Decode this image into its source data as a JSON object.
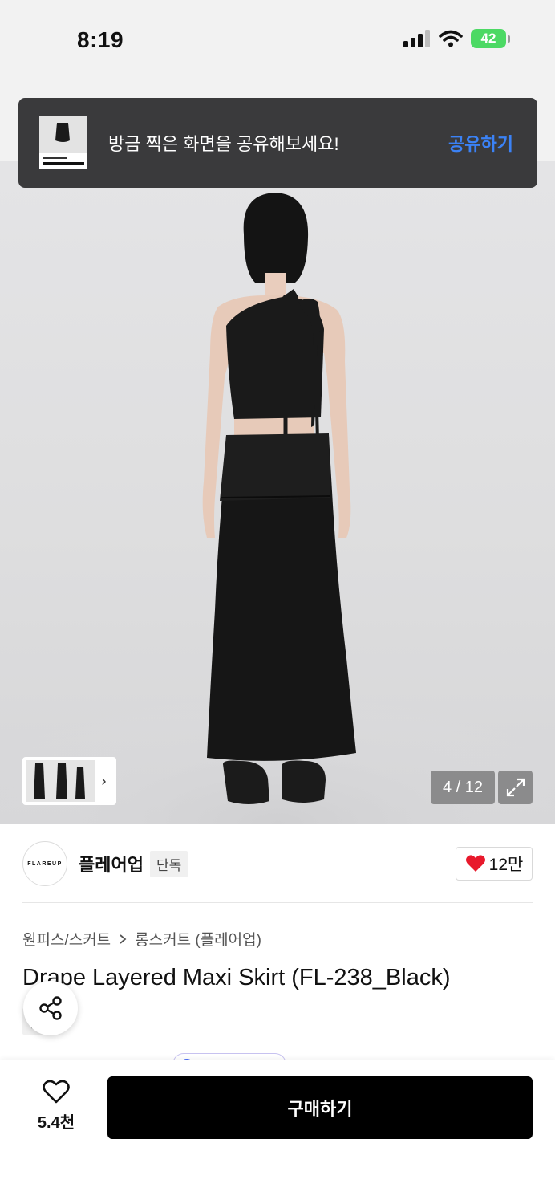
{
  "status_bar": {
    "time": "8:19",
    "battery": "42"
  },
  "toast": {
    "message": "방금 찍은 화면을 공유해보세요!",
    "action": "공유하기"
  },
  "gallery": {
    "counter": "4 / 12"
  },
  "brand": {
    "logo_text": "FLAREUP",
    "name": "플레어업",
    "badge": "단독",
    "likes": "12만"
  },
  "breadcrumb": {
    "category": "원피스/스커트",
    "sub_category": "롱스커트 (플레어업)"
  },
  "product": {
    "title": "Drape Layered Maxi Skirt (FL-238_Black)",
    "badge": "단독"
  },
  "bottom_bar": {
    "wish_count": "5.4천",
    "buy_label": "구매하기"
  },
  "colors": {
    "accent": "#3b82f6",
    "like": "#e8192c",
    "buy_bg": "#000000"
  }
}
